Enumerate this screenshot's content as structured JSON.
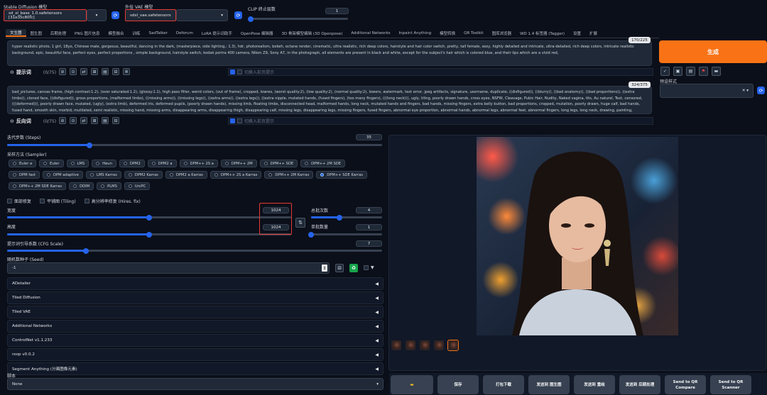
{
  "top": {
    "model_label": "Stable Diffusion 模型",
    "model_value": "sd_xl_base_1.0.safetensors [31e35c80fc]",
    "vae_label": "外挂 VAE 模型",
    "vae_value": "sdxl_vae.safetensors",
    "clip_label": "CLIP 终止层数",
    "clip_value": "1",
    "clip_fraction": 0.0
  },
  "tabs": [
    "文生图",
    "图生图",
    "后期处理",
    "PNG 图片信息",
    "模型融合",
    "训练",
    "SadTalker",
    "Deforum",
    "LoRA 提示词助手",
    "OpenPose 编辑器",
    "3D 骨架模型编辑 (3D Openpose)",
    "Additional Networks",
    "Inpaint Anything",
    "模型转换",
    "QR Toolkit",
    "图库浏览器",
    "WD 1.4 标签器 (Tagger)",
    "设置",
    "扩展"
  ],
  "prompt": {
    "text": "hyper realistic photo, 1 girl, 18yo, Chinese male, gorgeous, beautiful, dancing in the dark, (masterpiece, side lighting,: 1.3), hdr, photorealism, bokeh, octane render, cinematic, ultra realistic, rich deep colors, hairstyle and hair color switch, pretty, tall female, sexy, highly detailed and intricate, ultra-detailed, rich deep colors, intricate realistic background, epic, beautiful face, perfect eyes, perfect proportions , simple background, hairstyle switch, kodak portra 400 camera, Nikon Z9, Sony A7, in the photograph, all elements are present in black and white, except for the subject's hair which is colored blue, and their lips which are a vivid red,",
    "counter": "170/225",
    "label": "提示词",
    "count": "(0/75)",
    "checkbox_label": "切换入前页提示"
  },
  "negative": {
    "text": "bad_pictures, canvas frame, (high contrast:1.2), (over saturated:1.2), (glossy:1.1), high pass filter, weird colors, (out of frame), cropped, lowres, (worst quality:2), (low quality:2), (normal quality:2), lowers, watermark, text error, jpeg artifacts, signature, username, duplicate, ((disfigured)), ((blurry)), ((bad anatomy)), ((bad proportions)), ((extra limbs)), cloned face, ((disfigured)), gross proportions, (malformed limbs), ((missing arms)), ((missing legs)), ((extra arms)), ((extra legs)), ((extra nipple, mutated hands, (fused fingers), (too many fingers), (((long neck))), ugly, tiling, poorly drawn hands, cross eyes, NSFW, Cleavage, Pubic Hair, Nudity, Naked vagina, tits, Au naturel, Text, censored, (((deformed))), poorly drawn face, mutated, (ugly), (extra limb), deformed iris, deformed pupils, (poorly drawn hands), missing limb, floating limbs, disconnected head, malformed hands, long neck, mutated hands and fingers, bad hands, missing fingers, extra belly button, bad proportions, cropped, mutation, poorly drawn, huge calf, bad hands, fused hand, smooth skin, morbid, mutilated, semi realistic, missing hand, missing arms, disappearing arms, disappearing thigh, disappearing calf, missing legs, disappearing legs, missing fingers, fused fingers, abnormal eye proportion, abnormal hands, abnormal legs, abnormal feet, abnormal fingers, long legs, long neck, drawing, painting, crayon, sketch, graphite, impressionist, noisy, blurry, soft, deformed, ugly,",
    "counter": "324/375",
    "label": "反向词",
    "count": "(0/75)",
    "checkbox_label": "切换入前页提示"
  },
  "right": {
    "generate": "生成",
    "styles_label": "预设样式"
  },
  "steps": {
    "label": "迭代步数 (Steps)",
    "value": "35",
    "fraction": 0.22
  },
  "sampler": {
    "label": "采样方法 (Sampler)",
    "options": [
      "Euler a",
      "Euler",
      "LMS",
      "Heun",
      "DPM2",
      "DPM2 a",
      "DPM++ 2S a",
      "DPM++ 2M",
      "DPM++ SDE",
      "DPM++ 2M SDE",
      "DPM fast",
      "DPM adaptive",
      "LMS Karras",
      "DPM2 Karras",
      "DPM2 a Karras",
      "DPM++ 2S a Karras",
      "DPM++ 2M Karras",
      "DPM++ SDE Karras",
      "DPM++ 2M SDE Karras",
      "DDIM",
      "PLMS",
      "UniPC"
    ],
    "selected": "DPM++ SDE Karras"
  },
  "checks": [
    "面部修复",
    "平铺图 (Tiling)",
    "高分辨率修复 (Hires. fix)"
  ],
  "width": {
    "label": "宽度",
    "value": "1024",
    "fraction": 0.5
  },
  "height": {
    "label": "高度",
    "value": "1024",
    "fraction": 0.5
  },
  "batch_count": {
    "label": "总批次数",
    "value": "4",
    "fraction": 0.4
  },
  "batch_size": {
    "label": "单批数量",
    "value": "1",
    "fraction": 0.0
  },
  "cfg": {
    "label": "提示词引导系数 (CFG Scale)",
    "value": "7",
    "fraction": 0.21
  },
  "seed": {
    "label": "随机数种子 (Seed)",
    "value": "-1"
  },
  "accordions": [
    "ADetailer",
    "Tiled Diffusion",
    "Tiled VAE",
    "Additional Networks",
    "ControlNet v1.1.233",
    "roop v0.0.2",
    "Segment Anything (分离图像元素)"
  ],
  "script": {
    "label": "脚本",
    "value": "None"
  },
  "output_buttons": [
    "",
    "保存",
    "打包下载",
    "发送到 图生图",
    "发送到 重绘",
    "发送到 后期处理",
    "Send to QR Compare",
    "Send to QR Scanner"
  ],
  "colors": {
    "accent": "#f97316",
    "primary": "#2563eb",
    "bg": "#0b0f19",
    "red_highlight": "#e53935"
  }
}
